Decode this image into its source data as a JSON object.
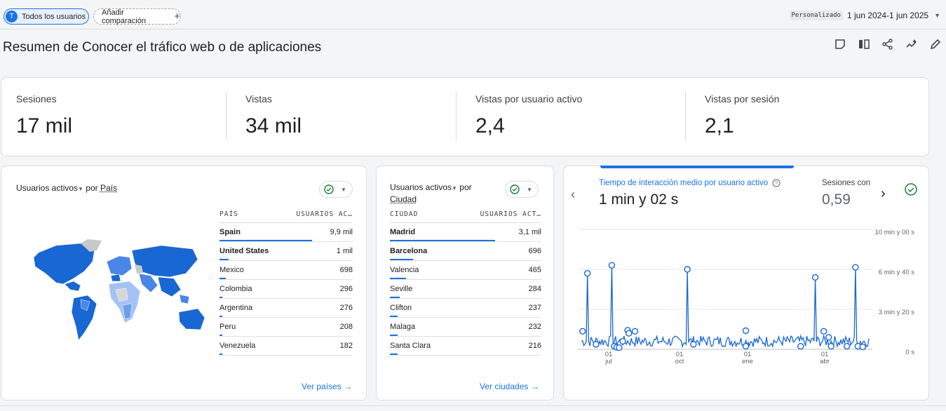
{
  "header": {
    "users_chip_initial": "T",
    "users_chip_label": "Todos los usuarios",
    "add_comparison_label": "Añadir comparación",
    "date_custom_label": "Personalizado",
    "date_range": "1 jun 2024-1 jun 2025"
  },
  "page": {
    "title": "Resumen de Conocer el tráfico web o de aplicaciones"
  },
  "toolbar_icons": [
    "comment-icon",
    "compare-columns-icon",
    "share-icon",
    "insights-icon",
    "edit-icon"
  ],
  "kpis": [
    {
      "label": "Sesiones",
      "value": "17 mil"
    },
    {
      "label": "Vistas",
      "value": "34 mil"
    },
    {
      "label": "Vistas por usuario activo",
      "value": "2,4"
    },
    {
      "label": "Vistas por sesión",
      "value": "2,1"
    }
  ],
  "country_card": {
    "metric": "Usuarios activos",
    "by": "por",
    "dimension": "País",
    "col_dim": "PAÍS",
    "col_metric": "USUARIOS AC…",
    "rows": [
      {
        "name": "Spain",
        "value": "9,9 mil",
        "share": 0.99
      },
      {
        "name": "United States",
        "value": "1 mil",
        "share": 0.1
      },
      {
        "name": "Mexico",
        "value": "698",
        "share": 0.07
      },
      {
        "name": "Colombia",
        "value": "296",
        "share": 0.03
      },
      {
        "name": "Argentina",
        "value": "276",
        "share": 0.028
      },
      {
        "name": "Peru",
        "value": "208",
        "share": 0.021
      },
      {
        "name": "Venezuela",
        "value": "182",
        "share": 0.018
      }
    ],
    "link": "Ver países →"
  },
  "city_card": {
    "metric": "Usuarios activos",
    "by": "por",
    "dimension": "Ciudad",
    "col_dim": "CIUDAD",
    "col_metric": "USUARIOS ACT…",
    "rows": [
      {
        "name": "Madrid",
        "value": "3,1 mil",
        "share": 0.99
      },
      {
        "name": "Barcelona",
        "value": "696",
        "share": 0.22
      },
      {
        "name": "Valencia",
        "value": "465",
        "share": 0.15
      },
      {
        "name": "Seville",
        "value": "284",
        "share": 0.09
      },
      {
        "name": "Clifton",
        "value": "237",
        "share": 0.076
      },
      {
        "name": "Malaga",
        "value": "232",
        "share": 0.074
      },
      {
        "name": "Santa Clara",
        "value": "216",
        "share": 0.07
      }
    ],
    "link": "Ver ciudades →"
  },
  "chart_card": {
    "metric_label": "Tiempo de interacción medio por usuario activo",
    "metric_value": "1 min y 02 s",
    "second_label": "Sesiones con",
    "second_value": "0,59"
  },
  "chart_data": {
    "type": "line",
    "y_tick_labels": [
      "10 min y 00 s",
      "6 min y 40 s",
      "3 min y 20 s",
      "0 s"
    ],
    "ylim": [
      0,
      600
    ],
    "x_tick_labels": [
      [
        "01",
        "jul"
      ],
      [
        "01",
        "oct"
      ],
      [
        "01",
        "ene"
      ],
      [
        "01",
        "abr"
      ]
    ],
    "x_range": [
      0,
      365
    ],
    "baseline_seconds": 40,
    "spikes": [
      {
        "x": 5,
        "y": 380
      },
      {
        "x": 25,
        "y": 420
      },
      {
        "x": 87,
        "y": 400
      },
      {
        "x": 192,
        "y": 360
      },
      {
        "x": 225,
        "y": 410
      }
    ],
    "marked_points": [
      {
        "x": 1,
        "y": 90
      },
      {
        "x": 5,
        "y": 380
      },
      {
        "x": 12,
        "y": 25
      },
      {
        "x": 25,
        "y": 420
      },
      {
        "x": 27,
        "y": 15
      },
      {
        "x": 29,
        "y": 10
      },
      {
        "x": 31,
        "y": 8
      },
      {
        "x": 34,
        "y": 40
      },
      {
        "x": 38,
        "y": 95
      },
      {
        "x": 39,
        "y": 80
      },
      {
        "x": 44,
        "y": 90
      },
      {
        "x": 87,
        "y": 400
      },
      {
        "x": 92,
        "y": 25
      },
      {
        "x": 135,
        "y": 93
      },
      {
        "x": 135,
        "y": 15
      },
      {
        "x": 180,
        "y": 15
      },
      {
        "x": 192,
        "y": 360
      },
      {
        "x": 199,
        "y": 90
      },
      {
        "x": 203,
        "y": 60
      },
      {
        "x": 205,
        "y": 15
      },
      {
        "x": 218,
        "y": 15
      },
      {
        "x": 225,
        "y": 410
      },
      {
        "x": 227,
        "y": 15
      },
      {
        "x": 231,
        "y": 12
      }
    ]
  }
}
